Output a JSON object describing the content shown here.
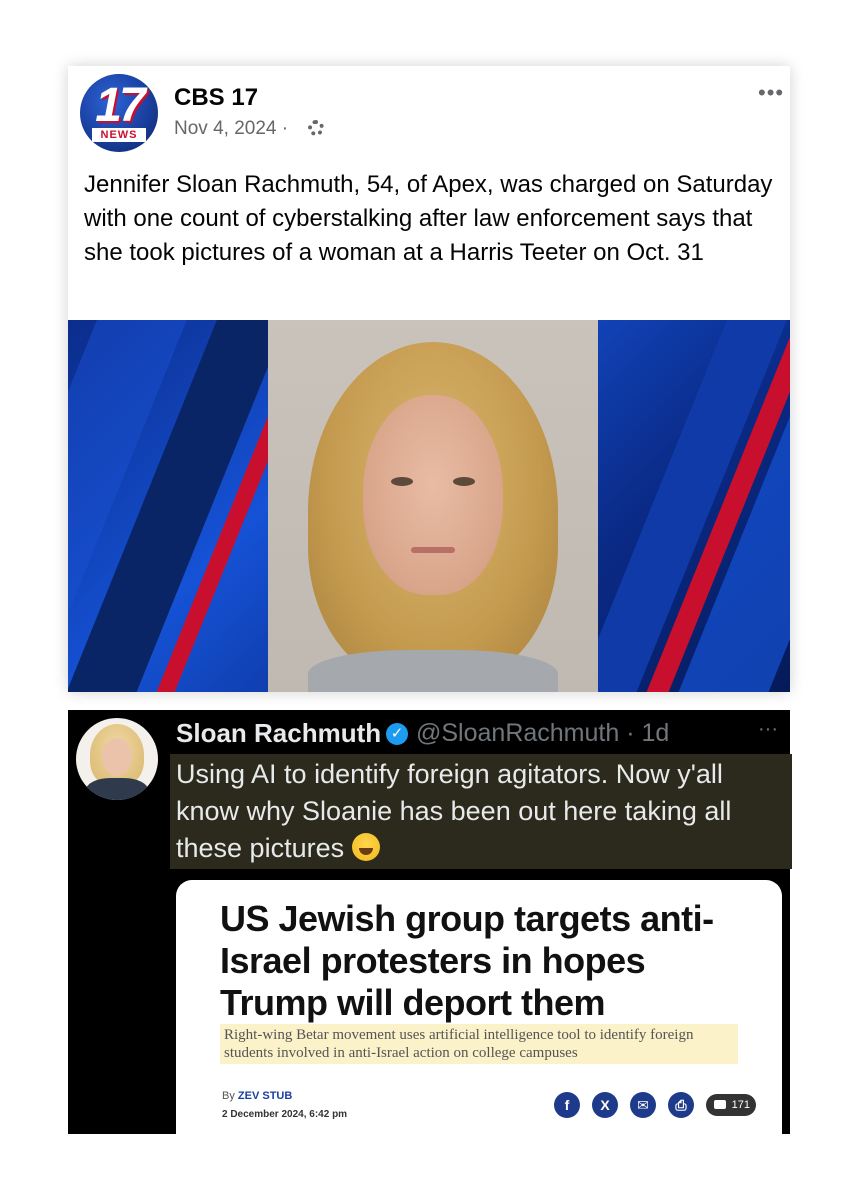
{
  "fb_post": {
    "page_name": "CBS 17",
    "date": "Nov 4, 2024 ·",
    "logo_number": "17",
    "logo_news": "NEWS",
    "more_label": "•••",
    "text": "Jennifer Sloan Rachmuth, 54, of Apex, was charged on Saturday with one count of cyberstalking after law enforcement says that she took pictures of a woman at a Harris Teeter on Oct. 31",
    "icons": [
      "settings-gear-icon",
      "more-options-icon"
    ]
  },
  "tweet": {
    "name": "Sloan Rachmuth",
    "verified_glyph": "✓",
    "handle_time": "@SloanRachmuth · 1d",
    "more_label": "···",
    "text": "Using AI to identify foreign agitators. Now y'all know why Sloanie has been out here taking all these pictures",
    "emoji": "face-with-tears-of-joy-icon"
  },
  "news_card": {
    "headline": "US Jewish group targets anti-Israel protesters in hopes Trump will deport them",
    "subheadline": "Right-wing Betar movement uses artificial intelligence tool to identify foreign students involved in anti-Israel action on college campuses",
    "byline_prefix": "By ",
    "author": "ZEV STUB",
    "date": "2 December 2024, 6:42 pm",
    "share": {
      "facebook": "f",
      "x": "X",
      "email": "✉",
      "print": "⎙"
    },
    "comment_count": "171"
  },
  "colors": {
    "fb_text": "#050505",
    "fb_meta": "#65676b",
    "tweet_bg": "#000000",
    "tweet_text": "#e7e9ea",
    "tweet_highlight": "#2b2a1c",
    "verified": "#1d9bf0",
    "news_highlight": "#fbf2c9",
    "share_button": "#1e3a8a"
  }
}
